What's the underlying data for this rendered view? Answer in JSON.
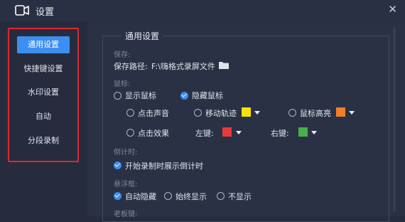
{
  "window": {
    "title": "设置"
  },
  "sidebar": {
    "items": [
      {
        "label": "通用设置"
      },
      {
        "label": "快捷键设置"
      },
      {
        "label": "水印设置"
      },
      {
        "label": "自动"
      },
      {
        "label": "分段录制"
      }
    ]
  },
  "general": {
    "title": "通用设置",
    "save": {
      "section": "保存:",
      "path_label": "保存路径:",
      "path_value": "F:\\嗨格式录屏文件"
    },
    "mouse": {
      "section": "鼠标:",
      "show_cursor": "显示鼠标",
      "hide_cursor": "隐藏鼠标",
      "click_sound": "点击声音",
      "move_track": "移动轨迹",
      "cursor_highlight": "鼠标高亮",
      "click_effect": "点击效果",
      "left_key": "左键:",
      "right_key": "右键:"
    },
    "countdown": {
      "section": "倒计时:",
      "show_on_start": "开始录制时展示倒计时"
    },
    "float_window": {
      "section": "悬浮框:",
      "auto_hide": "自动隐藏",
      "always_show": "始终显示",
      "never_show": "不显示"
    },
    "boss_key": {
      "section": "老板键:"
    }
  },
  "colors": {
    "accent": "#3b8ff0",
    "move_track_color": "#f5e10c",
    "cursor_highlight_color": "#f07e2a",
    "left_key_color": "#e83a3a",
    "right_key_color": "#48b04a",
    "highlight_frame": "#e0262d"
  },
  "state": {
    "cursor": "hide_cursor",
    "countdown_checked": true,
    "float_window": "auto_hide"
  }
}
